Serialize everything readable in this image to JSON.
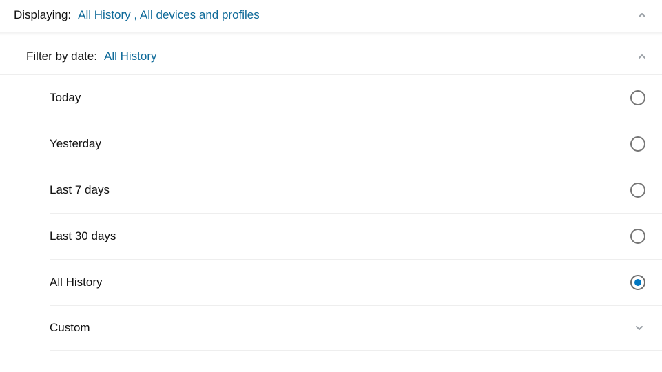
{
  "header": {
    "label": "Displaying:",
    "value": "All History , All devices and profiles"
  },
  "filter": {
    "label": "Filter by date:",
    "value": "All History"
  },
  "options": [
    {
      "label": "Today",
      "selected": false,
      "kind": "radio"
    },
    {
      "label": "Yesterday",
      "selected": false,
      "kind": "radio"
    },
    {
      "label": "Last 7 days",
      "selected": false,
      "kind": "radio"
    },
    {
      "label": "Last 30 days",
      "selected": false,
      "kind": "radio"
    },
    {
      "label": "All History",
      "selected": true,
      "kind": "radio"
    },
    {
      "label": "Custom",
      "selected": false,
      "kind": "expand"
    }
  ],
  "colors": {
    "link": "#0F6A99",
    "radio_fill": "#0077c1",
    "chevron": "#9aa0a6"
  }
}
